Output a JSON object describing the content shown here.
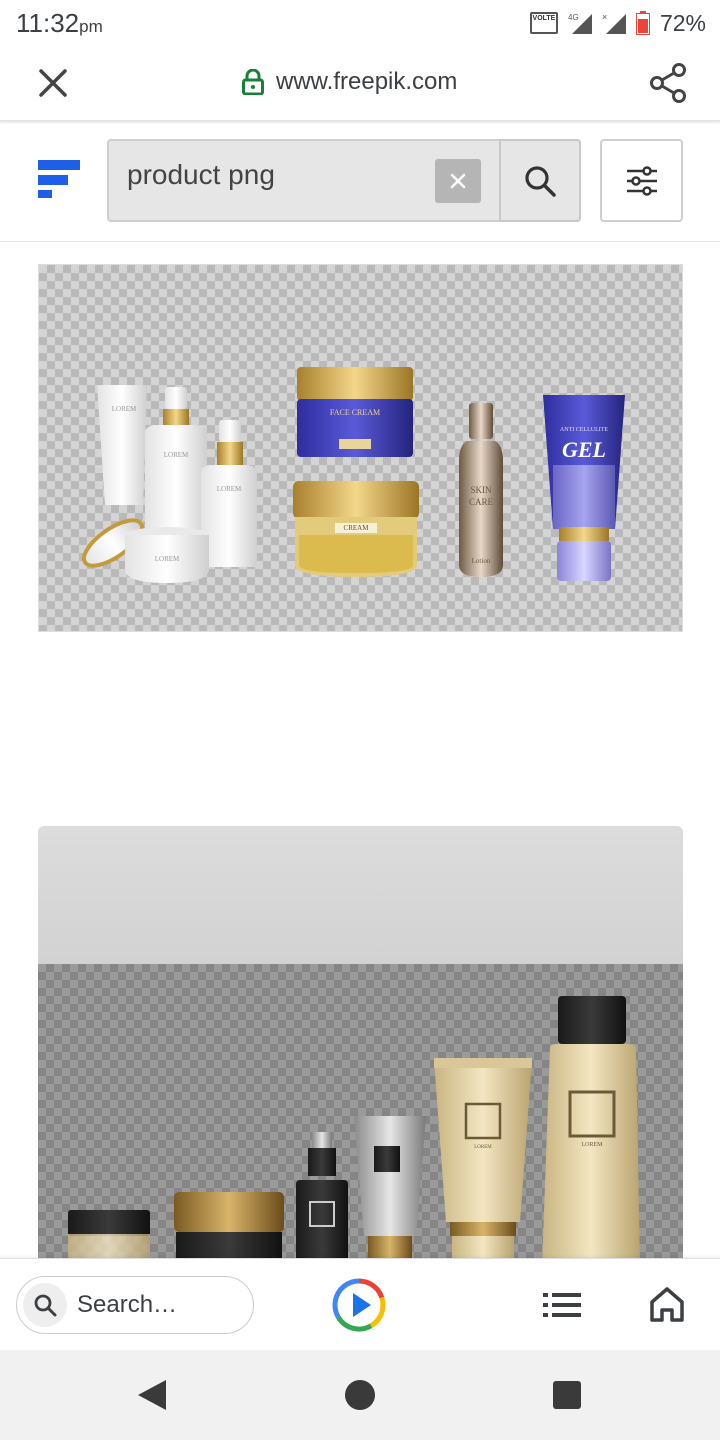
{
  "status_bar": {
    "time": "11:32",
    "ampm": "pm",
    "volte_label": "VOLTE",
    "network_label": "4G",
    "battery_percent": "72%",
    "battery_level": 0.72
  },
  "url_bar": {
    "url": "www.freepik.com",
    "icons": [
      "close-icon",
      "lock-icon",
      "share-icon"
    ]
  },
  "site_header": {
    "brand": "freepik",
    "search_query": "product png",
    "icons": [
      "clear-icon",
      "search-icon",
      "filter-sliders-icon"
    ]
  },
  "results": [
    {
      "type": "image",
      "background": "transparency-checker",
      "labels": {
        "face_cream": "FACE CREAM",
        "cream": "CREAM",
        "skin_care_1": "SKIN",
        "skin_care_2": "CARE",
        "lotion": "Lotion",
        "anti_cellulite": "ANTI CELLULITE",
        "gel": "GEL",
        "lorem": "LOREM"
      }
    },
    {
      "type": "image",
      "background": "transparency-checker",
      "labels": {
        "lorem": "LOREM"
      }
    }
  ],
  "bottom_toolbar": {
    "search_placeholder": "Search…",
    "icons": [
      "search-icon",
      "google-play-icon",
      "list-icon",
      "home-icon"
    ]
  },
  "nav_bar": {
    "icons": [
      "back-icon",
      "home-circle-icon",
      "recents-icon"
    ]
  },
  "colors": {
    "brand_blue": "#1e5fe8",
    "lock_green": "#188038"
  }
}
